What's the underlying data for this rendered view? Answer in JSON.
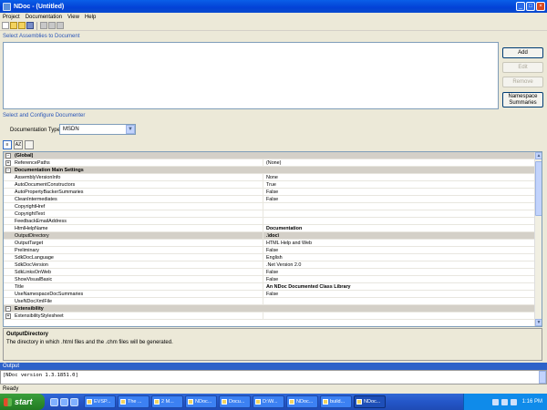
{
  "window": {
    "title": "NDoc - (Untitled)"
  },
  "menu": {
    "items": [
      "Project",
      "Documentation",
      "View",
      "Help"
    ]
  },
  "assemblies": {
    "header": "Select Assemblies to Document",
    "buttons": {
      "add": "Add",
      "edit": "Edit",
      "remove": "Remove",
      "namespace": "Namespace Summaries"
    }
  },
  "documenter": {
    "header": "Select and Configure Documenter",
    "type_label": "Documentation Type:",
    "type_value": "MSDN"
  },
  "grid": {
    "rows": [
      {
        "kind": "cat",
        "expander": "−",
        "name": "(Global)",
        "value": ""
      },
      {
        "kind": "prop",
        "expander": "+",
        "name": "ReferencePaths",
        "value": "(None)"
      },
      {
        "kind": "cat",
        "expander": "−",
        "name": "Documentation Main Settings",
        "value": ""
      },
      {
        "kind": "prop",
        "name": "AssemblyVersionInfo",
        "value": "None"
      },
      {
        "kind": "prop",
        "name": "AutoDocumentConstructors",
        "value": "True"
      },
      {
        "kind": "prop",
        "name": "AutoPropertyBackerSummaries",
        "value": "False"
      },
      {
        "kind": "prop",
        "name": "CleanIntermediates",
        "value": "False"
      },
      {
        "kind": "prop",
        "name": "CopyrightHref",
        "value": ""
      },
      {
        "kind": "prop",
        "name": "CopyrightText",
        "value": ""
      },
      {
        "kind": "prop",
        "name": "FeedbackEmailAddress",
        "value": ""
      },
      {
        "kind": "prop",
        "name": "HtmlHelpName",
        "value": "Documentation",
        "bold": true
      },
      {
        "kind": "prop",
        "name": "OutputDirectory",
        "value": ".\\doc\\",
        "bold": true,
        "selected": true
      },
      {
        "kind": "prop",
        "name": "OutputTarget",
        "value": "HTML Help and Web"
      },
      {
        "kind": "prop",
        "name": "Preliminary",
        "value": "False"
      },
      {
        "kind": "prop",
        "name": "SdkDocLanguage",
        "value": "English"
      },
      {
        "kind": "prop",
        "name": "SdkDocVersion",
        "value": ".Net Version 2.0"
      },
      {
        "kind": "prop",
        "name": "SdkLinksOnWeb",
        "value": "False"
      },
      {
        "kind": "prop",
        "name": "ShowVisualBasic",
        "value": "False"
      },
      {
        "kind": "prop",
        "name": "Title",
        "value": "An NDoc Documented Class Library",
        "bold": true
      },
      {
        "kind": "prop",
        "name": "UseNamespaceDocSummaries",
        "value": "False"
      },
      {
        "kind": "prop",
        "name": "UseNDocXmlFile",
        "value": ""
      },
      {
        "kind": "cat",
        "expander": "−",
        "name": "Extensibility",
        "value": ""
      },
      {
        "kind": "prop",
        "expander": "+",
        "name": "ExtensibilityStylesheet",
        "value": ""
      }
    ]
  },
  "description": {
    "title": "OutputDirectory",
    "text": "The directory in which .html files and the .chm files will be generated."
  },
  "output": {
    "header": "Output",
    "text": "[NDoc version 1.3.1851.0]"
  },
  "status": {
    "text": "Ready"
  },
  "taskbar": {
    "start": "start",
    "tasks": [
      "EVSP...",
      "The ...",
      "2 M...",
      "NDoc...",
      "Docu...",
      "D:\\W...",
      "NDoc...",
      "build...",
      "NDoc..."
    ],
    "clock": "1:16 PM"
  }
}
